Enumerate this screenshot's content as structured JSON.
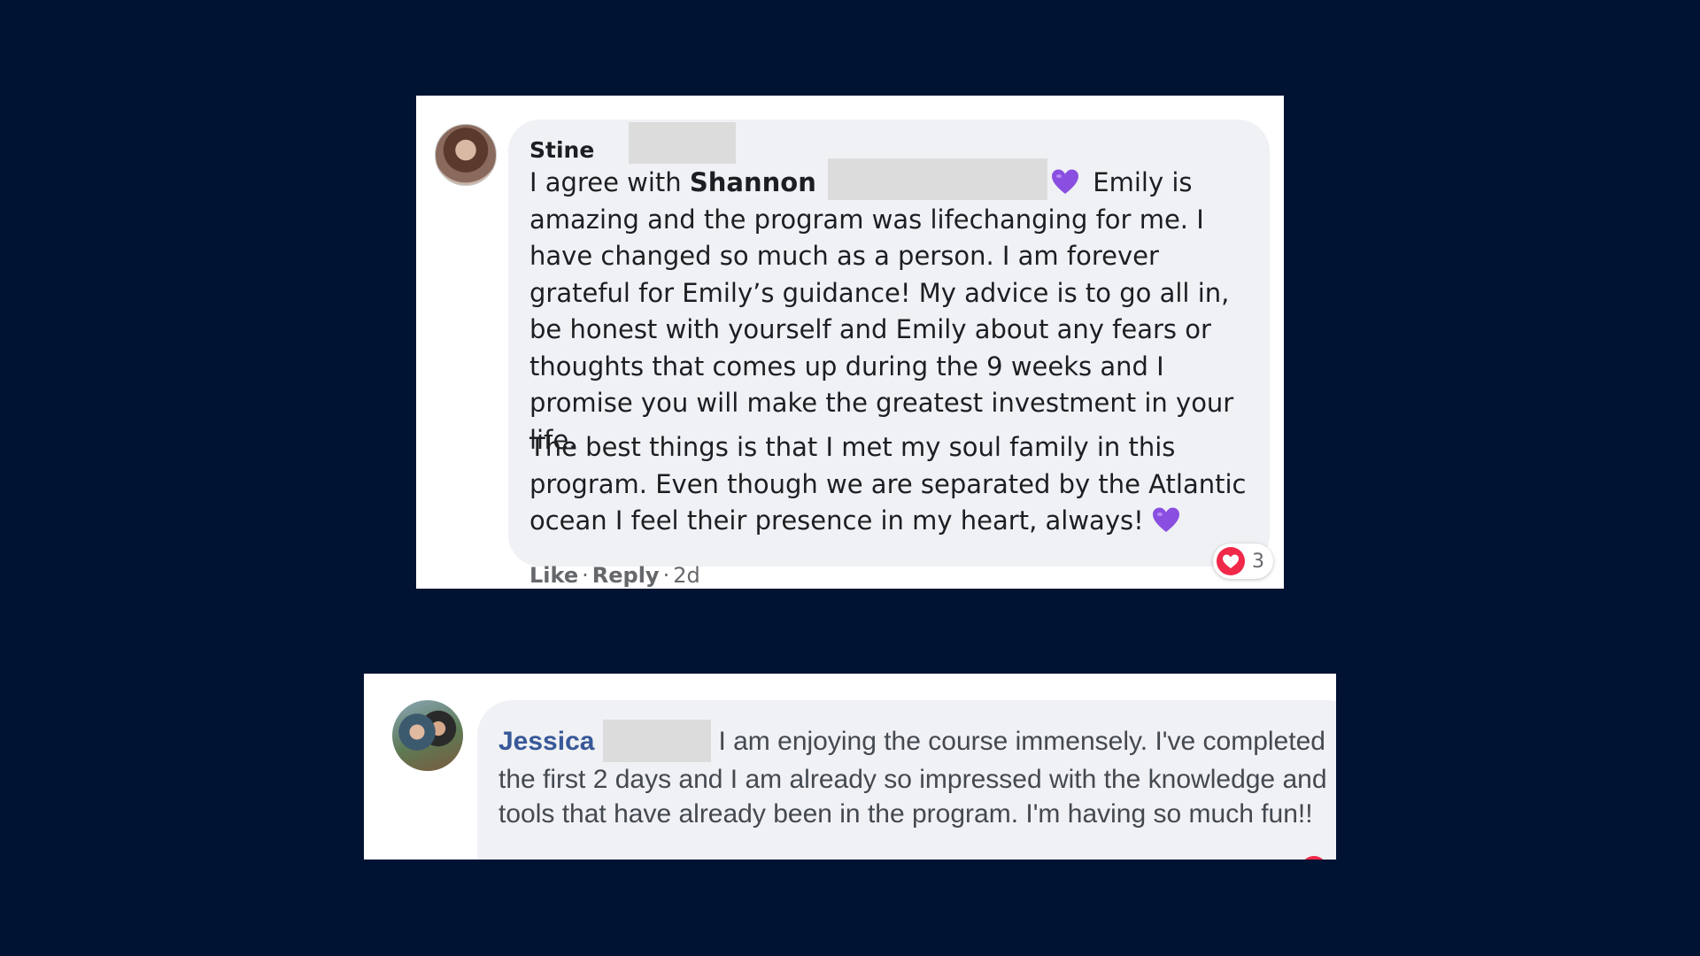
{
  "comments": [
    {
      "author": "Stine",
      "mention_prefix": "I agree with ",
      "mention": "Shannon",
      "after_mention": " Emily is amazing and the program was lifechanging for me. I have changed so much as a person. I am forever grateful for Emily’s guidance! My advice is to go all in, be honest with yourself and Emily about any fears or thoughts that comes up during the 9 weeks and I promise you will make the greatest investment in your life.",
      "paragraph2": "The best things is that I met my soul family in this program. Even though we are separated by the Atlantic ocean I feel their presence in my heart, always!",
      "actions": {
        "like": "Like",
        "reply": "Reply",
        "separator": "·",
        "time": "2d"
      },
      "reaction_count": "3",
      "colors": {
        "heart": "#8a4fe0",
        "love_reaction": "#f0284a"
      }
    },
    {
      "author": "Jessica",
      "text": "I am enjoying the course immensely. I've completed the first 2 days and I am already so impressed with the knowledge and tools that have already been in the program. I'm having so much fun!!",
      "colors": {
        "author": "#385898"
      }
    }
  ],
  "icons": [
    "purple-heart-icon",
    "love-reaction-icon"
  ],
  "colors": {
    "background": "#011333",
    "bubble": "#eff1f4"
  }
}
